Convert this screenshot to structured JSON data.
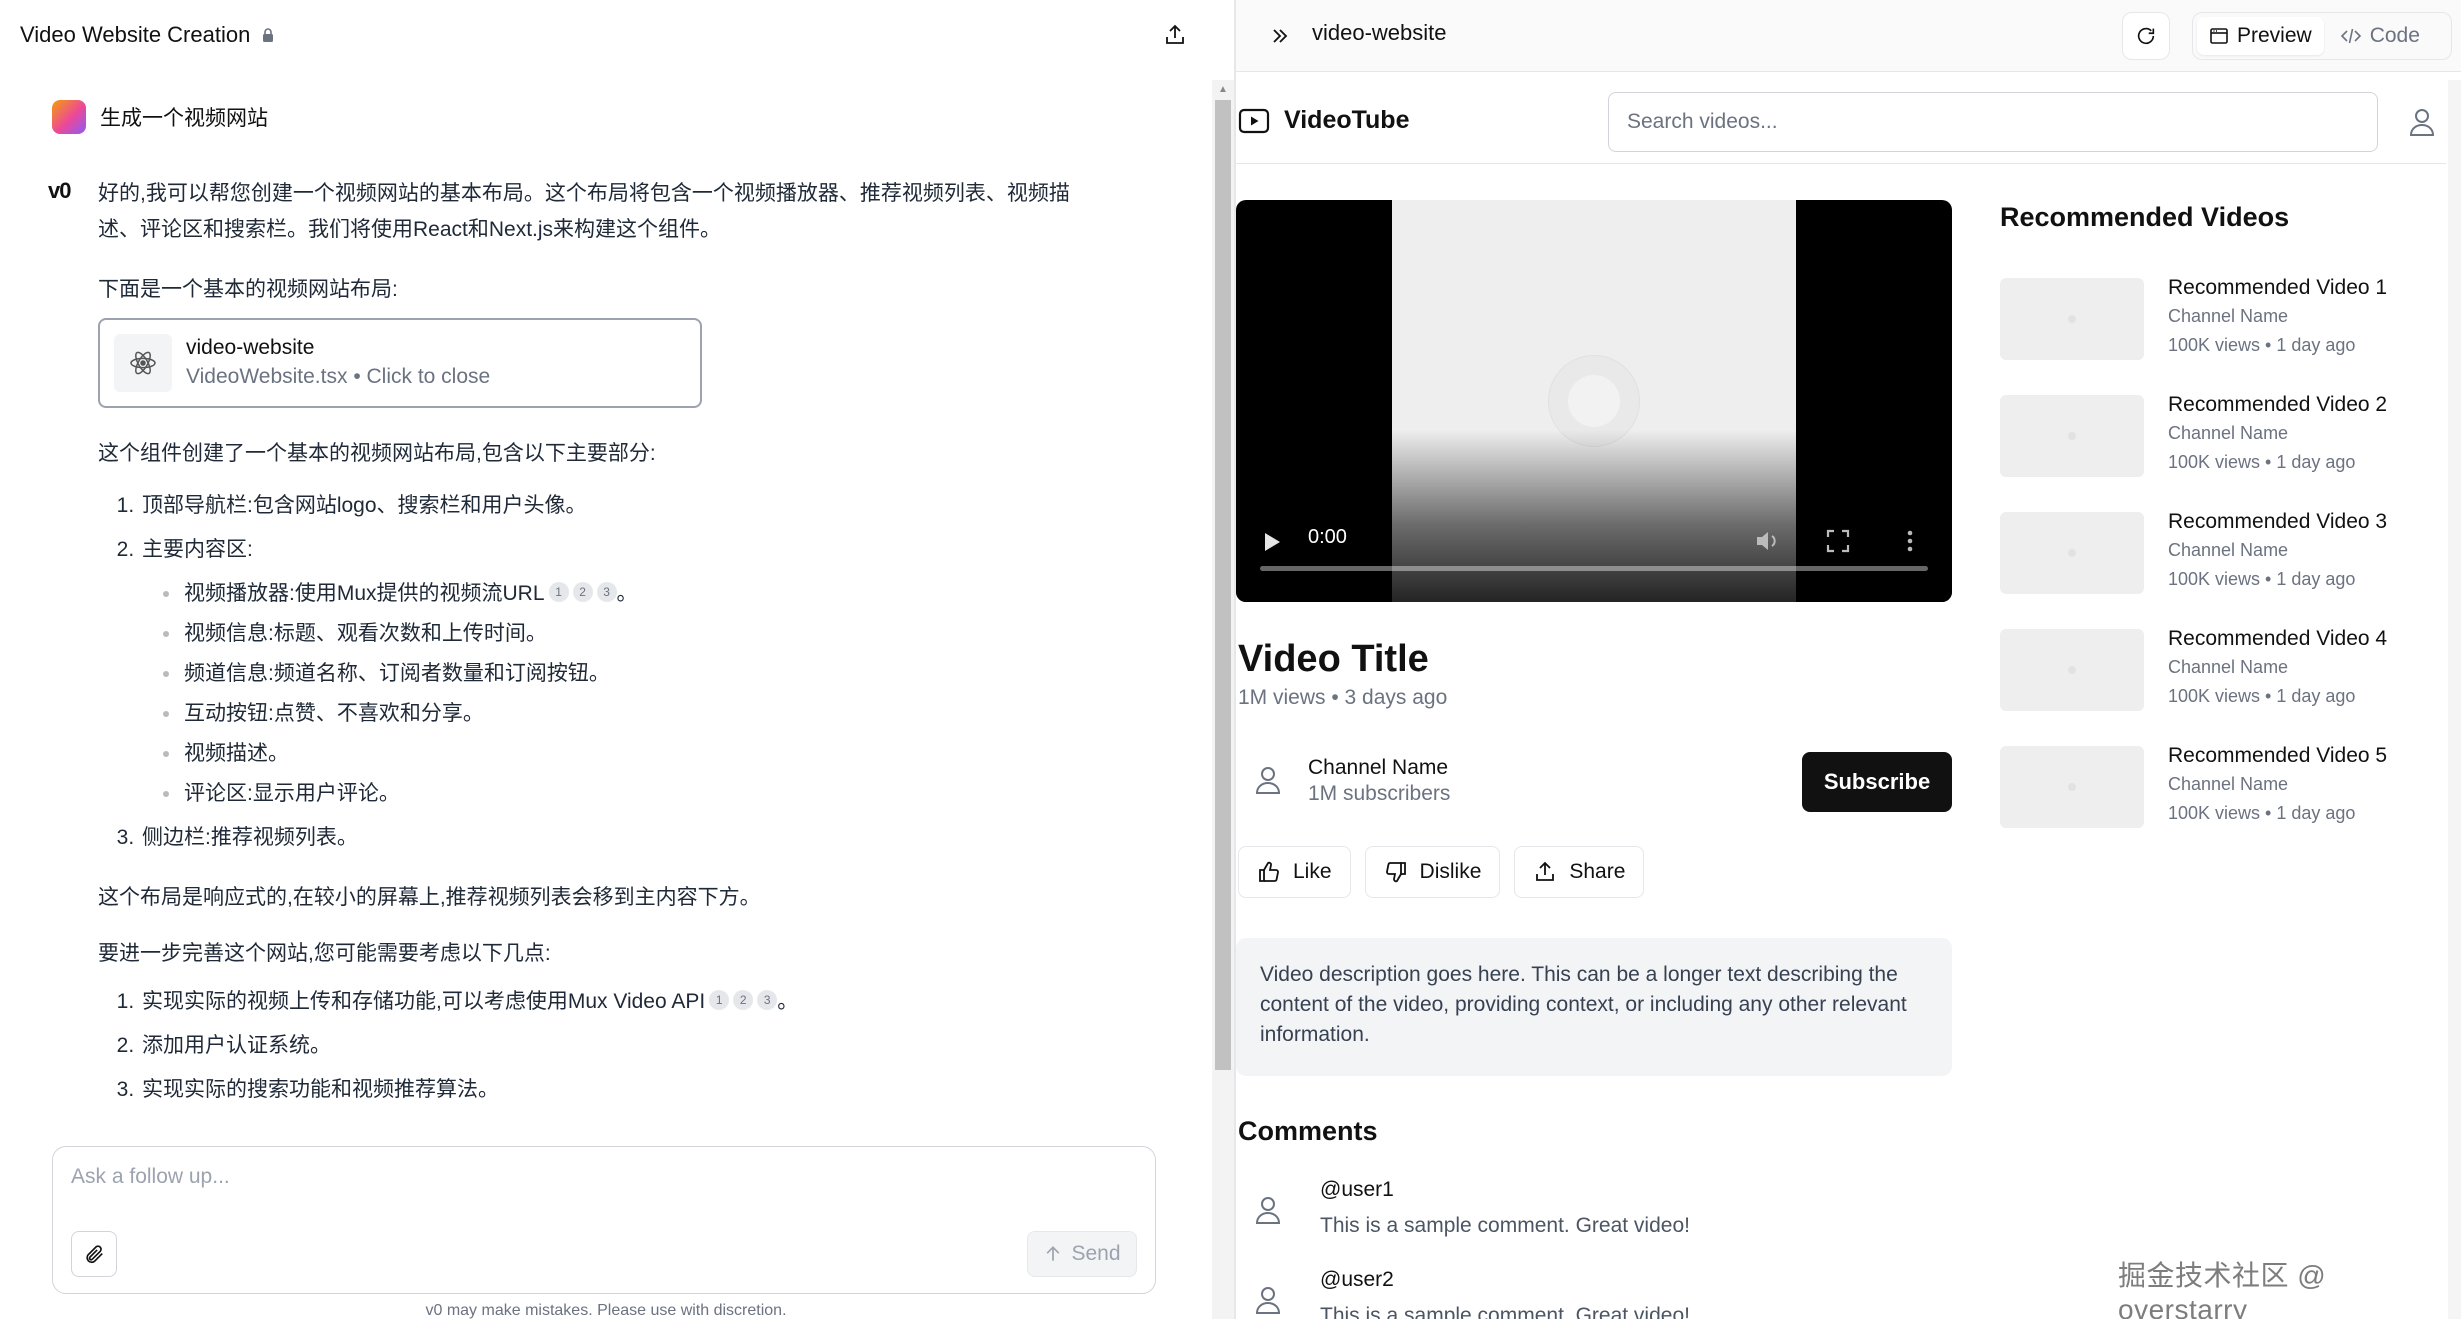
{
  "chat": {
    "title": "Video Website Creation",
    "user_message": "生成一个视频网站",
    "bot_logo": "v0",
    "intro": "好的,我可以帮您创建一个视频网站的基本布局。这个布局将包含一个视频播放器、推荐视频列表、视频描述、评论区和搜索栏。我们将使用React和Next.js来构建这个组件。",
    "layout_heading": "下面是一个基本的视频网站布局:",
    "file_card": {
      "name": "video-website",
      "subtitle": "VideoWebsite.tsx • Click to close"
    },
    "summary": "这个组件创建了一个基本的视频网站布局,包含以下主要部分:",
    "list1": {
      "item1": "顶部导航栏:包含网站logo、搜索栏和用户头像。",
      "item2": "主要内容区:",
      "sub": [
        "视频播放器:使用Mux提供的视频流URL",
        "视频信息:标题、观看次数和上传时间。",
        "频道信息:频道名称、订阅者数量和订阅按钮。",
        "互动按钮:点赞、不喜欢和分享。",
        "视频描述。",
        "评论区:显示用户评论。"
      ],
      "item3": "侧边栏:推荐视频列表。"
    },
    "responsive_note": "这个布局是响应式的,在较小的屏幕上,推荐视频列表会移到主内容下方。",
    "next_steps_heading": "要进一步完善这个网站,您可能需要考虑以下几点:",
    "list2": [
      "实现实际的视频上传和存储功能,可以考虑使用Mux Video API",
      "添加用户认证系统。",
      "实现实际的搜索功能和视频推荐算法。"
    ],
    "citations": [
      "1",
      "2",
      "3"
    ],
    "period": "。",
    "input_placeholder": "Ask a follow up...",
    "send_label": "Send",
    "disclaimer": "v0 may make mistakes. Please use with discretion."
  },
  "preview": {
    "name": "video-website",
    "tab_preview": "Preview",
    "tab_code": "Code"
  },
  "site": {
    "logo_text": "VideoTube",
    "search_placeholder": "Search videos...",
    "player_time": "0:00",
    "video_title": "Video Title",
    "video_meta": "1M views • 3 days ago",
    "channel_name": "Channel Name",
    "channel_subs": "1M subscribers",
    "subscribe_label": "Subscribe",
    "like_label": "Like",
    "dislike_label": "Dislike",
    "share_label": "Share",
    "description": "Video description goes here. This can be a longer text describing the content of the video, providing context, or including any other relevant information.",
    "comments_title": "Comments",
    "comments": [
      {
        "user": "@user1",
        "text": "This is a sample comment. Great video!"
      },
      {
        "user": "@user2",
        "text": "This is a sample comment. Great video!"
      }
    ],
    "rec_title": "Recommended Videos",
    "recommended": [
      {
        "title": "Recommended Video 1",
        "channel": "Channel Name",
        "meta": "100K views • 1 day ago"
      },
      {
        "title": "Recommended Video 2",
        "channel": "Channel Name",
        "meta": "100K views • 1 day ago"
      },
      {
        "title": "Recommended Video 3",
        "channel": "Channel Name",
        "meta": "100K views • 1 day ago"
      },
      {
        "title": "Recommended Video 4",
        "channel": "Channel Name",
        "meta": "100K views • 1 day ago"
      },
      {
        "title": "Recommended Video 5",
        "channel": "Channel Name",
        "meta": "100K views • 1 day ago"
      }
    ]
  },
  "watermark": "掘金技术社区 @ overstarry"
}
